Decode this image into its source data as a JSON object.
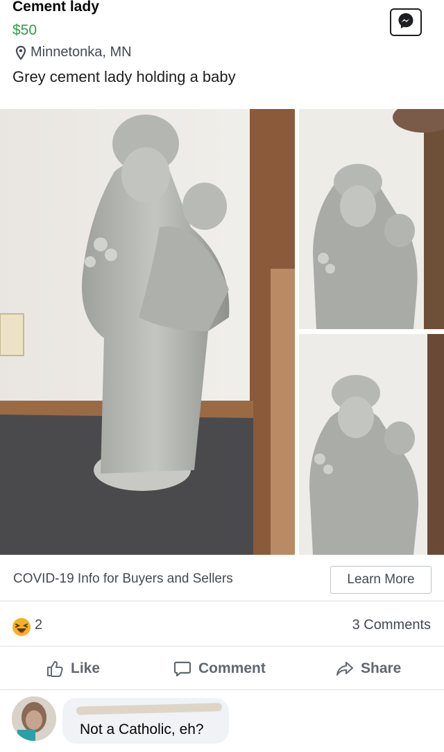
{
  "listing": {
    "title": "Cement lady",
    "price": "$50",
    "location": "Minnetonka, MN",
    "description": "Grey cement lady holding a baby"
  },
  "icons": {
    "location": "map-pin-icon",
    "messenger": "messenger-icon",
    "reaction": "haha-emoji-icon",
    "like": "thumbs-up-icon",
    "comment": "speech-bubble-icon",
    "share": "share-arrow-icon"
  },
  "colors": {
    "price": "#2f9e44",
    "secondary_text": "#444950",
    "reaction_yellow": "#f7b125"
  },
  "covid_banner": {
    "text": "COVID-19 Info for Buyers and Sellers",
    "button_label": "Learn More"
  },
  "stats": {
    "reaction_count": "2",
    "comments_label": "3 Comments"
  },
  "actions": {
    "like": "Like",
    "comment": "Comment",
    "share": "Share"
  },
  "comment": {
    "text": "Not a Catholic, eh?"
  }
}
